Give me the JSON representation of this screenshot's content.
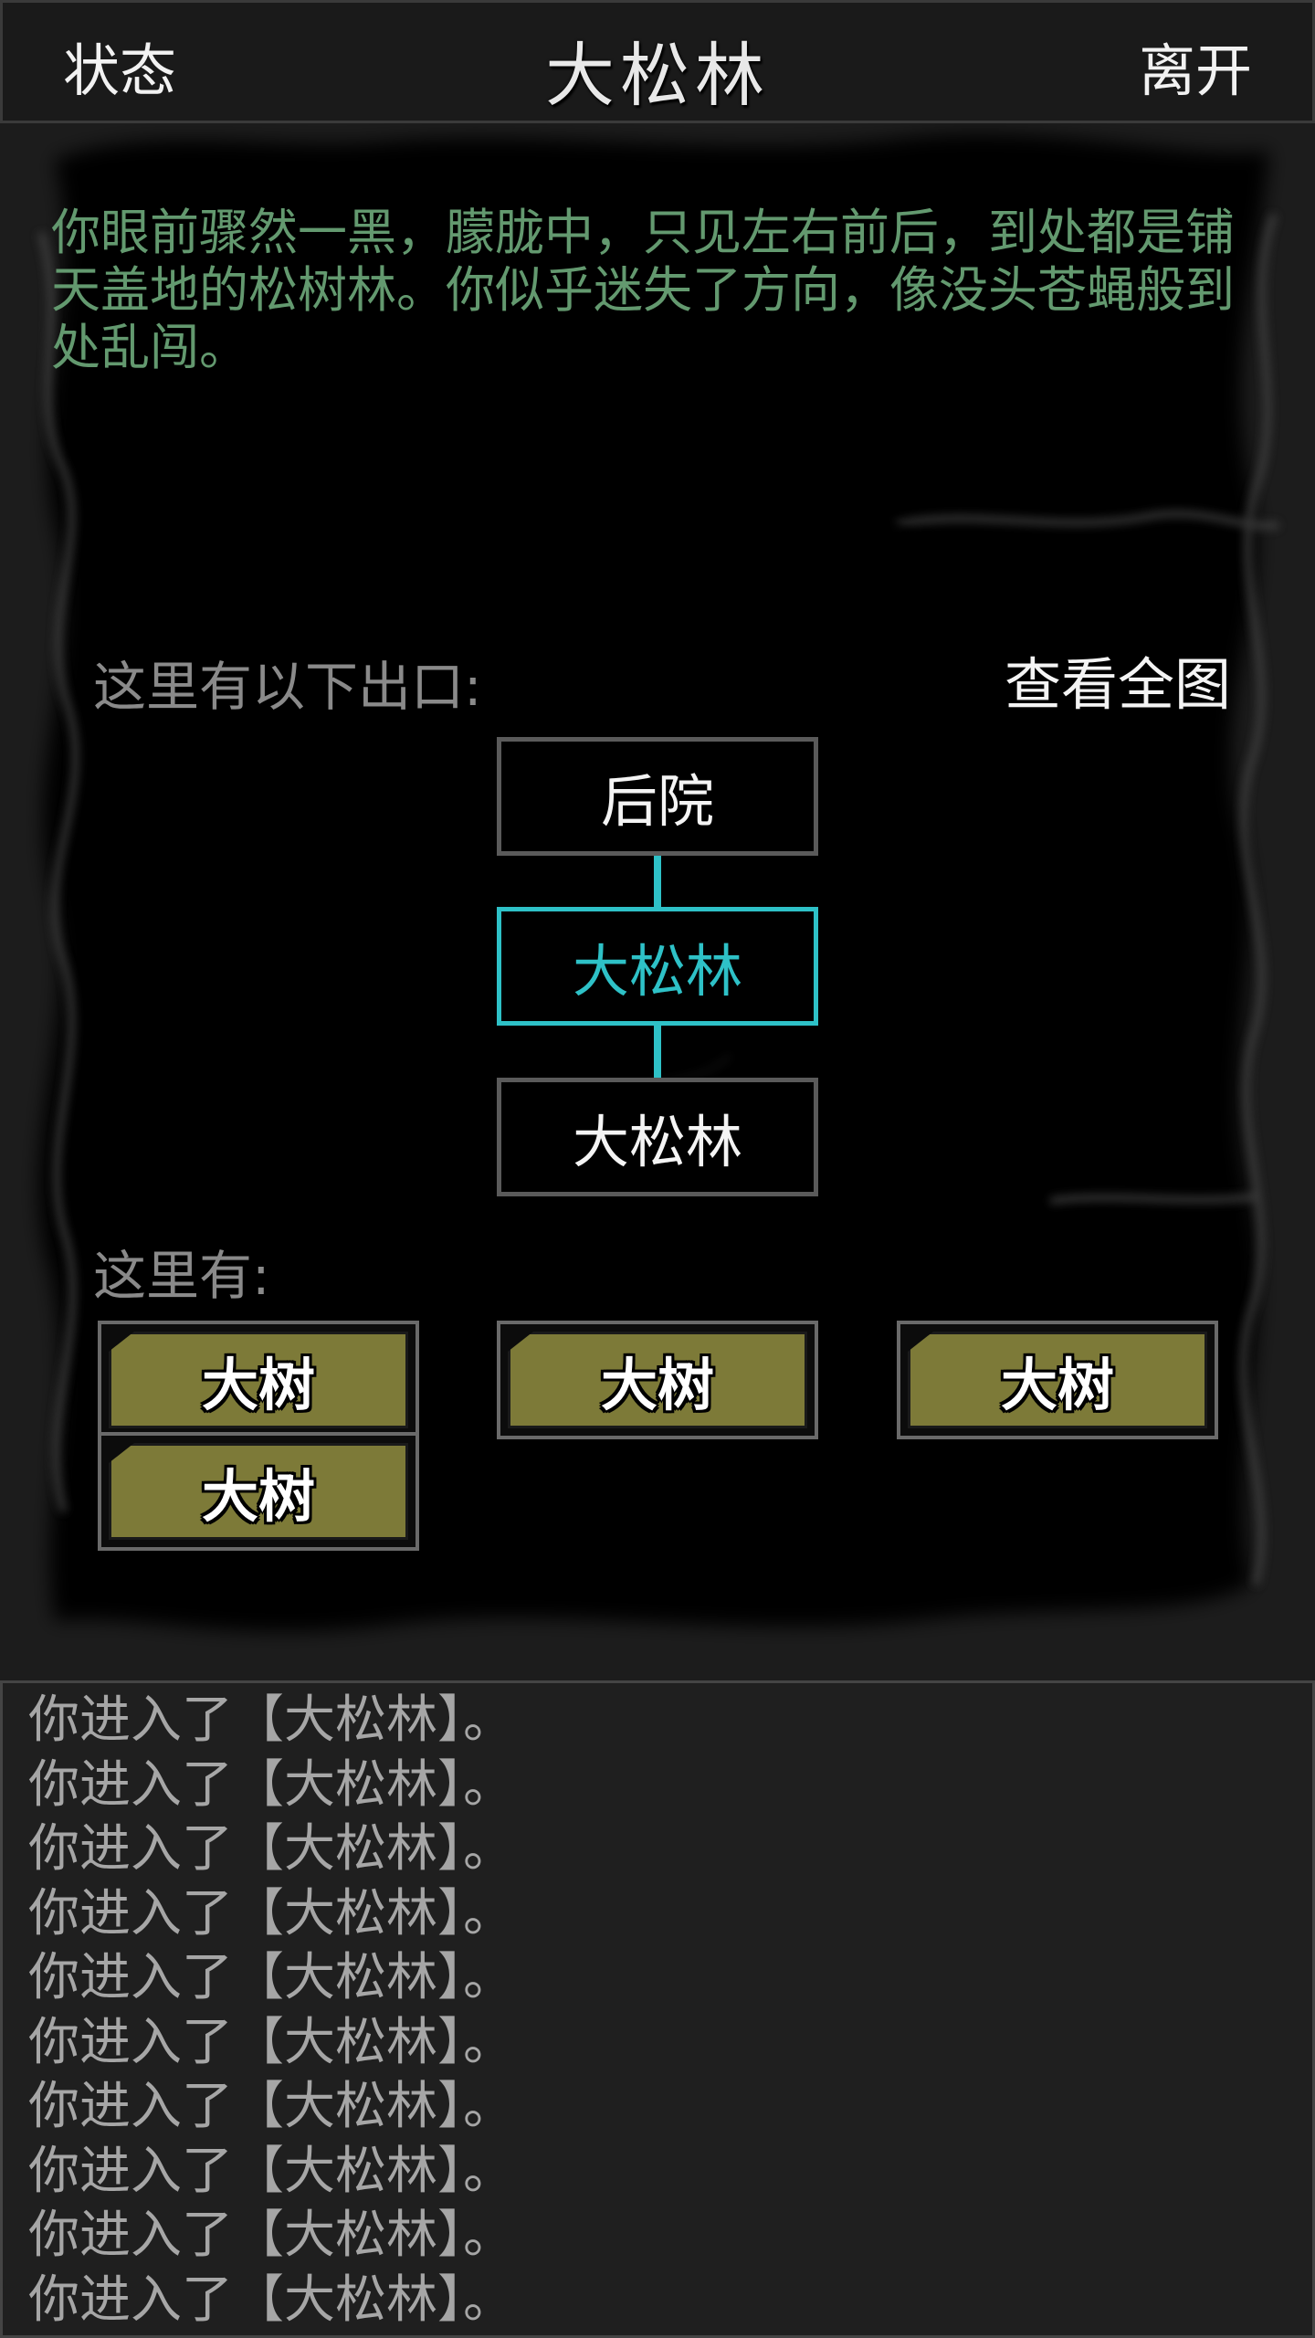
{
  "header": {
    "left_button": "状态",
    "title": "大松林",
    "right_button": "离开"
  },
  "room": {
    "description": "你眼前骤然一黑，朦胧中，只见左右前后，到处都是铺天盖地的松树林。你似乎迷失了方向，像没头苍蝇般到处乱闯。"
  },
  "exits": {
    "label": "这里有以下出口:",
    "full_map_button": "查看全图",
    "north": "后院",
    "current": "大松林",
    "south": "大松林",
    "current_color": "#2ec1c7"
  },
  "items": {
    "label": "这里有:",
    "list": [
      "大树",
      "大树",
      "大树",
      "大树"
    ],
    "button_color": "#7d7a38"
  },
  "log": {
    "lines": [
      "你进入了【大松林】。",
      "你进入了【大松林】。",
      "你进入了【大松林】。",
      "你进入了【大松林】。",
      "你进入了【大松林】。",
      "你进入了【大松林】。",
      "你进入了【大松林】。",
      "你进入了【大松林】。",
      "你进入了【大松林】。",
      "你进入了【大松林】。"
    ]
  }
}
